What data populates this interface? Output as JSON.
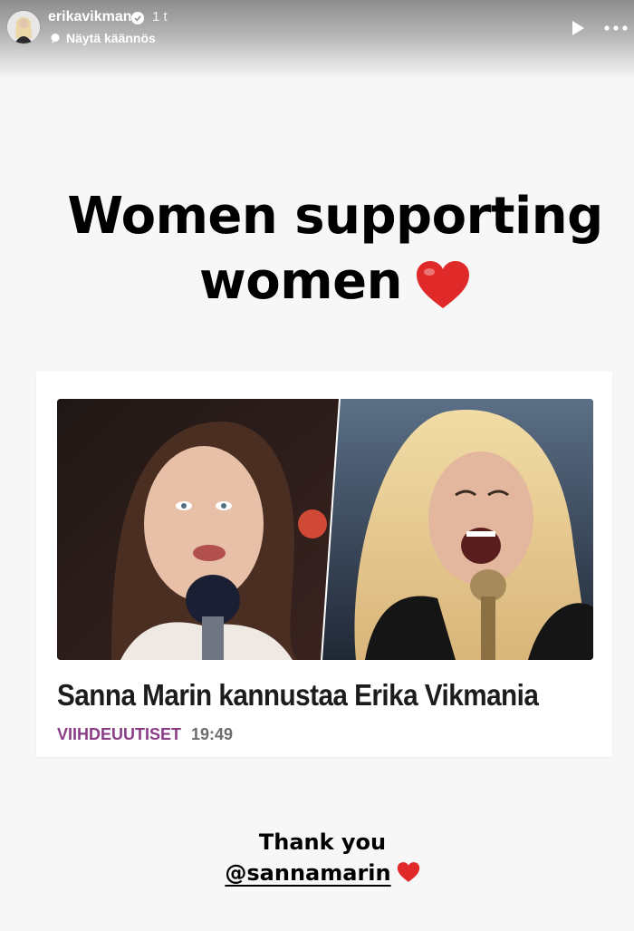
{
  "header": {
    "username": "erikavikman",
    "time_ago": "1 t",
    "translate_label": "Näytä käännös"
  },
  "story": {
    "headline_line1": "Women supporting",
    "headline_line2": "women",
    "headline_emoji": "red-heart"
  },
  "article": {
    "title": "Sanna Marin kannustaa Erika Vikmania",
    "category": "VIIHDEUUTISET",
    "time": "19:49",
    "category_color": "#8a3d86"
  },
  "footer": {
    "thanks": "Thank you",
    "mention": "@sannamarin",
    "emoji": "red-heart"
  },
  "colors": {
    "heart": "#e02a2a",
    "background": "#f7f7f7"
  },
  "icons": [
    "verified-badge-icon",
    "translate-icon",
    "play-icon",
    "more-icon",
    "heart-icon"
  ]
}
